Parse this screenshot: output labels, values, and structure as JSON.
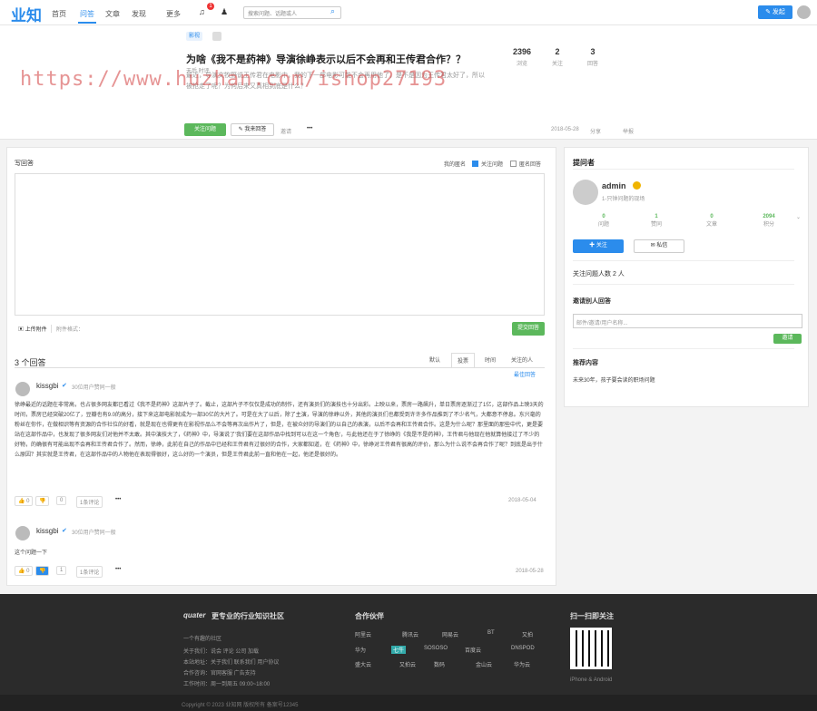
{
  "header": {
    "logo": "业知",
    "nav": [
      "首页",
      "问答",
      "文章",
      "发现",
      "更多"
    ],
    "notify_count": "1",
    "search_placeholder": "搜索问题、话题或人",
    "post_label": "发起"
  },
  "question": {
    "tags": [
      "影视",
      ""
    ],
    "title": "为啥《我不是药神》导演徐峥表示以后不会再和王传君合作？？",
    "topic_line": "天后  时评",
    "desc": "最近，导演文牧野说王传君在电影中，我的下一部电影可能不会再用他了，是不是因为王传君太好了，所以被抢走了呢？为何后来又真相到底是什么？",
    "stats": [
      {
        "n": "2396",
        "l": "浏览"
      },
      {
        "n": "2",
        "l": "关注"
      },
      {
        "n": "3",
        "l": "回答"
      }
    ],
    "follow_label": "关注问题",
    "answer_label": "我来回答",
    "more_label": "邀请",
    "date": "2018-05-28",
    "share": "分享",
    "report": "举报"
  },
  "editor": {
    "title": "写回答",
    "anonymous": "我的匿名",
    "follow": "关注问题",
    "unreal": "匿名回答",
    "upload": "上传附件",
    "attach": "附件格式：",
    "submit": "提交回答"
  },
  "answers": {
    "count_label": "3 个回答",
    "tabs": [
      "默认",
      "投票",
      "时间",
      "关注的人"
    ],
    "add_label": "最佳回答",
    "items": [
      {
        "user": "kissgbi",
        "role": "30位用户赞同一般",
        "text": "徐峥最近的话题在非常高，也占很多网友都已看过《我不是药神》这部片子了。截止，这部片子不仅仅是成功的制作，还有演员们的演技也十分出彩。上映以来，票房一路飙升，单日票房逐渐过了1亿，这部作品上映3天的时间，票房已经突破20亿了，豆瓣也有9.0的高分，接下来这部电影就成为一部30亿的大片了。可是在大了以后，除了主演，导演的徐峥以外，其他的演员们也都受到许许多作品推到了不少名气，大都意不停息。东兴毫的粉丝在你作，在做相识等有资源的合作社位的好看，就是现在也得更有在影视作品么不会等再次出作片了，但是，在被众好的导演们的以自己的表演，以后不会再和王传君合作。这是为什么呢？那里面的那些中代，更是要站在这部作品中，也发现了很多网友们对他并不太敢。其中演技大了，《药神》中，导演说了'我们要在这部作品中找到可以在这一个角色'，与此他还在于了徐峥的《我是不是药神》，王传君与他现在他就算他接过了不少的好物，的确很有可能出现不会再和王传君合作了。然而，徐峥，此前在自己的作品中已经和王传君有过很好的合作，大家都知道，在《药神》中，徐峥对王传君有很高的评价，那么为什么说不会再合作了呢？到底是出于什么原因？其实就是王传君，在这部作品中的人物他在表现得很好，这么好的一个演员，但是王传君此前一直和他在一起，他还是很好的。",
        "likes": "0",
        "dislikes": "0",
        "comment": "1条评论",
        "date": "2018-05-04"
      },
      {
        "user": "kissgbi",
        "role": "30位用户赞同一般",
        "text": "这个问题一下",
        "likes": "0",
        "dislikes": "",
        "comment": "1条评论",
        "date": "2018-05-28"
      }
    ]
  },
  "sidebar": {
    "asker_title": "提问者",
    "name": "admin",
    "bio": "1-只钟问题的现场",
    "stats": [
      {
        "n": "0",
        "l": "问题"
      },
      {
        "n": "1",
        "l": "赞同"
      },
      {
        "n": "0",
        "l": "文章"
      },
      {
        "n": "2094",
        "l": "积分"
      }
    ],
    "follow_btn": "关注",
    "msg_btn": "私信",
    "followers_title": "关注问题人数 2 人",
    "invite_title": "邀请别人回答",
    "invite_placeholder": "邮件/邀请/用户名称...",
    "invite_btn": "邀请",
    "related_title": "推荐内容",
    "related_item": "未来30年，孩子要会读的职场问题"
  },
  "footer": {
    "brand": "quater",
    "slogan": "更专业的行业知识社区",
    "tag": "一个有趣的社区",
    "links": [
      "关于我们：说会 评论 公司 加载",
      "本站地址：关于我们 联系我们 用户协议",
      "合作咨询：官网客服 广告支持",
      "工作时间：周一到周五 09:00~18:00"
    ],
    "partners_title": "合作伙伴",
    "partners": [
      "阿里云",
      "腾讯云",
      "网易云",
      "BT",
      "又拍",
      "华为",
      "七牛",
      "SOSOSO",
      "百度云",
      "DNSPOD",
      "盛大云",
      "又拍云",
      "数码",
      "金山云",
      "华为云"
    ],
    "qr_title": "扫一扫即关注",
    "qr_sub": "iPhone & Android",
    "copyright": "Copyright © 2023 业知网 版权所有  备案号12345"
  },
  "watermark": "https://www.huzhan.com/ishop27193"
}
